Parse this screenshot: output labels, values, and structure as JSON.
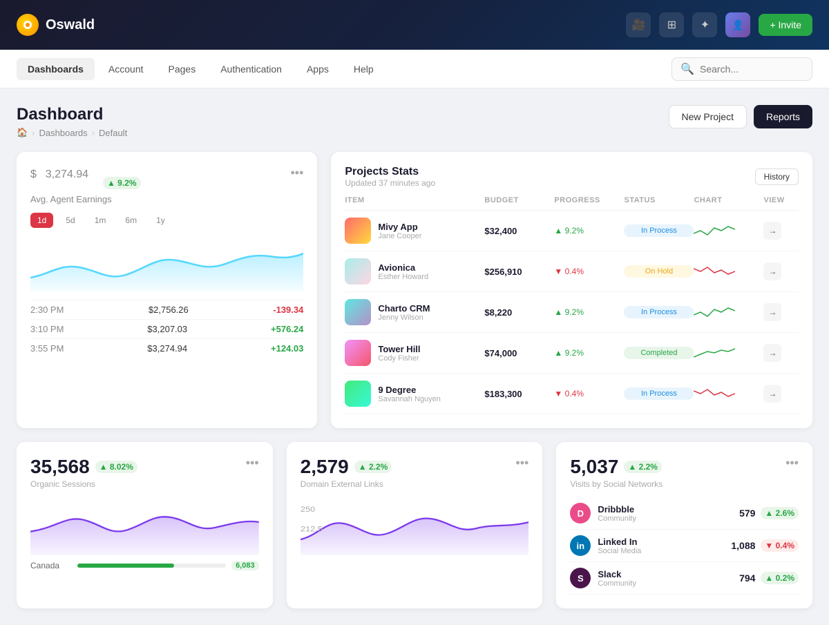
{
  "app": {
    "name": "Oswald",
    "invite_label": "+ Invite"
  },
  "nav": {
    "items": [
      {
        "label": "Dashboards",
        "active": true
      },
      {
        "label": "Account",
        "active": false
      },
      {
        "label": "Pages",
        "active": false
      },
      {
        "label": "Authentication",
        "active": false
      },
      {
        "label": "Apps",
        "active": false
      },
      {
        "label": "Help",
        "active": false
      }
    ],
    "search_placeholder": "Search..."
  },
  "page": {
    "title": "Dashboard",
    "breadcrumb": [
      "home",
      "Dashboards",
      "Default"
    ],
    "btn_new_project": "New Project",
    "btn_reports": "Reports"
  },
  "earnings": {
    "currency": "$",
    "amount": "3,274.94",
    "badge": "▲ 9.2%",
    "label": "Avg. Agent Earnings",
    "time_tabs": [
      "1d",
      "5d",
      "1m",
      "6m",
      "1y"
    ],
    "active_tab": "1d",
    "rows": [
      {
        "time": "2:30 PM",
        "value": "$2,756.26",
        "change": "-139.34",
        "positive": false
      },
      {
        "time": "3:10 PM",
        "value": "$3,207.03",
        "change": "+576.24",
        "positive": true
      },
      {
        "time": "3:55 PM",
        "value": "$3,274.94",
        "change": "+124.03",
        "positive": true
      }
    ]
  },
  "projects": {
    "title": "Projects Stats",
    "subtitle": "Updated 37 minutes ago",
    "btn_history": "History",
    "columns": [
      "ITEM",
      "BUDGET",
      "PROGRESS",
      "STATUS",
      "CHART",
      "VIEW"
    ],
    "rows": [
      {
        "name": "Mivy App",
        "person": "Jane Cooper",
        "budget": "$32,400",
        "progress": "▲ 9.2%",
        "progress_up": true,
        "status": "In Process",
        "status_class": "inprocess",
        "thumb_class": "thumb-1"
      },
      {
        "name": "Avionica",
        "person": "Esther Howard",
        "budget": "$256,910",
        "progress": "▼ 0.4%",
        "progress_up": false,
        "status": "On Hold",
        "status_class": "onhold",
        "thumb_class": "thumb-2"
      },
      {
        "name": "Charto CRM",
        "person": "Jenny Wilson",
        "budget": "$8,220",
        "progress": "▲ 9.2%",
        "progress_up": true,
        "status": "In Process",
        "status_class": "inprocess",
        "thumb_class": "thumb-3"
      },
      {
        "name": "Tower Hill",
        "person": "Cody Fisher",
        "budget": "$74,000",
        "progress": "▲ 9.2%",
        "progress_up": true,
        "status": "Completed",
        "status_class": "completed",
        "thumb_class": "thumb-4"
      },
      {
        "name": "9 Degree",
        "person": "Savannah Nguyen",
        "budget": "$183,300",
        "progress": "▼ 0.4%",
        "progress_up": false,
        "status": "In Process",
        "status_class": "inprocess",
        "thumb_class": "thumb-5"
      }
    ]
  },
  "organic": {
    "number": "35,568",
    "badge": "▲ 8.02%",
    "label": "Organic Sessions",
    "map_items": [
      {
        "country": "Canada",
        "value": "6,083"
      }
    ]
  },
  "domain": {
    "number": "2,579",
    "badge": "▲ 2.2%",
    "label": "Domain External Links"
  },
  "social": {
    "number": "5,037",
    "badge": "▲ 2.2%",
    "label": "Visits by Social Networks",
    "items": [
      {
        "name": "Dribbble",
        "type": "Community",
        "value": "579",
        "badge": "▲ 2.6%",
        "up": true,
        "color": "#ea4c89"
      },
      {
        "name": "Linked In",
        "type": "Social Media",
        "value": "1,088",
        "badge": "▼ 0.4%",
        "up": false,
        "color": "#0077b5"
      },
      {
        "name": "Slack",
        "type": "Community",
        "value": "794",
        "badge": "▲ 0.2%",
        "up": true,
        "color": "#4a154b"
      }
    ]
  }
}
